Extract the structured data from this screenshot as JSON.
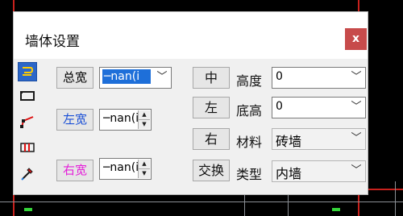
{
  "dialog": {
    "title": "墙体设置",
    "close_label": "x"
  },
  "toolbar": {
    "tools": [
      {
        "icon": "wall-draw-icon",
        "active": true
      },
      {
        "icon": "rectangle-wall-icon",
        "active": false
      },
      {
        "icon": "polyline-wall-icon",
        "active": false
      },
      {
        "icon": "grid-wall-icon",
        "active": false
      },
      {
        "icon": "eyedropper-icon",
        "active": false
      }
    ]
  },
  "widths": {
    "total_label": "总宽",
    "total_value": "─nan(i",
    "left_label": "左宽",
    "left_value": "─nan(i",
    "right_label": "右宽",
    "right_value": "─nan(i"
  },
  "position_buttons": {
    "center": "中",
    "left": "左",
    "right": "右",
    "swap": "交换"
  },
  "properties": {
    "height_label": "高度",
    "height_value": "0",
    "base_label": "底高",
    "base_value": "0",
    "material_label": "材料",
    "material_value": "砖墙",
    "type_label": "类型",
    "type_value": "内墙"
  },
  "colors": {
    "total_label_color": "#000000",
    "left_label_color": "#1a4fd6",
    "right_label_color": "#e51fd9",
    "close_bg": "#c74b4b",
    "active_tool_bg": "#2b66c8"
  }
}
